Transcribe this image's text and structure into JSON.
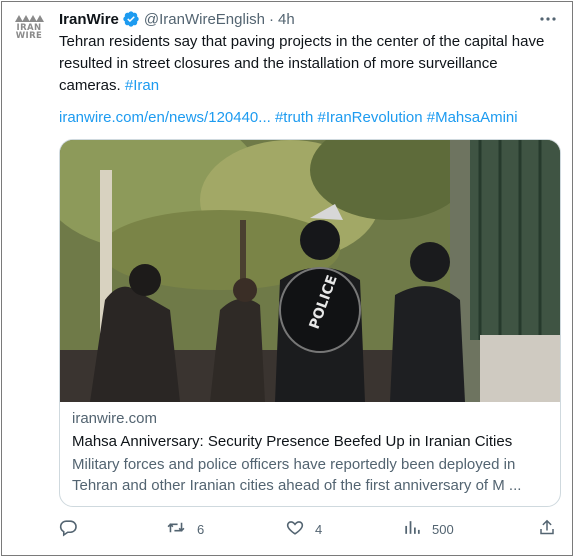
{
  "account": {
    "logo_text_top": "IRAN",
    "logo_text_bottom": "WIRE",
    "name": "IranWire",
    "handle": "@IranWireEnglish",
    "separator": "·",
    "time": "4h"
  },
  "tweet": {
    "text": "Tehran residents say that paving projects in the center of the capital have resulted in street closures and the installation of more surveillance cameras.",
    "hashtag_inline": "#Iran",
    "link_url": "iranwire.com/en/news/120440...",
    "hashtags": [
      "#truth",
      "#IranRevolution",
      "#MahsaAmini"
    ]
  },
  "card": {
    "image_text": "POLICE",
    "domain": "iranwire.com",
    "title": "Mahsa Anniversary: Security Presence Beefed Up in Iranian Cities",
    "description": "Military forces and police officers have reportedly been deployed in Tehran and other Iranian cities ahead of the first anniversary of M ..."
  },
  "actions": {
    "replies": "",
    "retweets": "6",
    "likes": "4",
    "views": "500"
  },
  "colors": {
    "link": "#1d9bf0",
    "verified": "#1d9bf0",
    "text_secondary": "#536471"
  },
  "icons": [
    "iranwire-logo-icon",
    "verified-badge-icon",
    "more-icon",
    "reply-icon",
    "retweet-icon",
    "like-icon",
    "views-icon",
    "share-icon"
  ]
}
